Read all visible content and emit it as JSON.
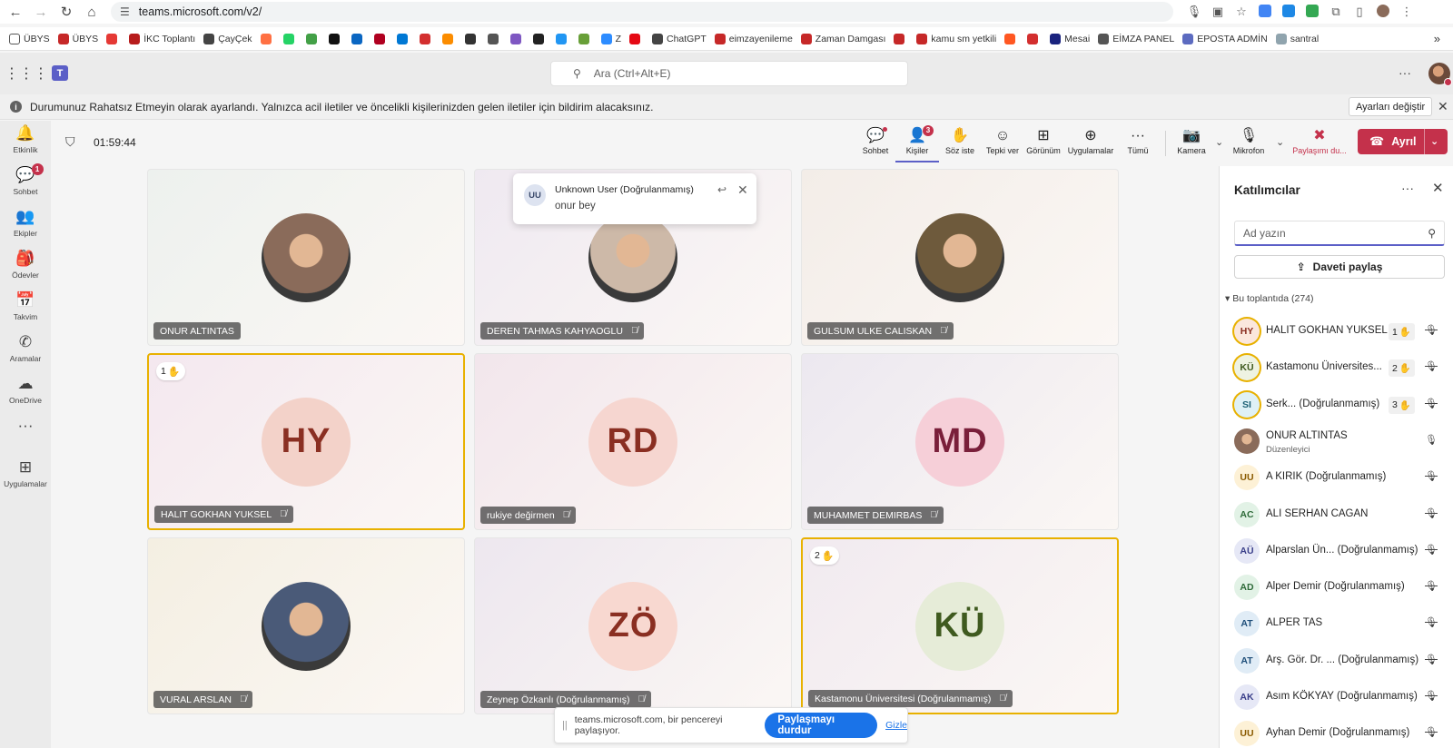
{
  "browser": {
    "url": "teams.microsoft.com/v2/",
    "bookmarks": [
      {
        "label": "ÜBYS",
        "color": "#555555"
      },
      {
        "label": "ÜBYS",
        "color": "#c62828"
      },
      {
        "label": "",
        "color": "#e53935"
      },
      {
        "label": "İKC Toplantı",
        "color": "#b71c1c"
      },
      {
        "label": "ÇayÇek",
        "color": "#444444"
      },
      {
        "label": "",
        "color": "#ff7043"
      },
      {
        "label": "",
        "color": "#25d366"
      },
      {
        "label": "",
        "color": "#43a047"
      },
      {
        "label": "",
        "color": "#111111"
      },
      {
        "label": "",
        "color": "#0a66c2"
      },
      {
        "label": "",
        "color": "#b00020"
      },
      {
        "label": "",
        "color": "#0078d4"
      },
      {
        "label": "",
        "color": "#d32f2f"
      },
      {
        "label": "",
        "color": "#fb8c00"
      },
      {
        "label": "",
        "color": "#333333"
      },
      {
        "label": "",
        "color": "#555555"
      },
      {
        "label": "",
        "color": "#7e57c2"
      },
      {
        "label": "",
        "color": "#222222"
      },
      {
        "label": "",
        "color": "#2196f3"
      },
      {
        "label": "",
        "color": "#689f38"
      },
      {
        "label": "Z",
        "color": "#2d8cff"
      },
      {
        "label": "",
        "color": "#e50914"
      },
      {
        "label": "ChatGPT",
        "color": "#444444"
      },
      {
        "label": "eimzayenileme",
        "color": "#c62828"
      },
      {
        "label": "Zaman Damgası",
        "color": "#c62828"
      },
      {
        "label": "",
        "color": "#c62828"
      },
      {
        "label": "kamu sm yetkili",
        "color": "#c62828"
      },
      {
        "label": "",
        "color": "#ff5722"
      },
      {
        "label": "",
        "color": "#d32f2f"
      },
      {
        "label": "Mesai",
        "color": "#1a237e"
      },
      {
        "label": "EİMZA PANEL",
        "color": "#555555"
      },
      {
        "label": "EPOSTA ADMİN",
        "color": "#5c6bc0"
      },
      {
        "label": "santral",
        "color": "#90a4ae"
      }
    ]
  },
  "teams": {
    "search_placeholder": "Ara (Ctrl+Alt+E)",
    "banner_text": "Durumunuz Rahatsız Etmeyin olarak ayarlandı. Yalnızca acil iletiler ve öncelikli kişilerinizden gelen iletiler için bildirim alacaksınız.",
    "banner_button": "Ayarları değiştir"
  },
  "rail": [
    {
      "label": "Etkinlik",
      "icon": "bell-icon",
      "badge": ""
    },
    {
      "label": "Sohbet",
      "icon": "chat-icon",
      "badge": "1"
    },
    {
      "label": "Ekipler",
      "icon": "teams-icon",
      "badge": ""
    },
    {
      "label": "Ödevler",
      "icon": "assignments-icon",
      "badge": ""
    },
    {
      "label": "Takvim",
      "icon": "calendar-icon",
      "badge": ""
    },
    {
      "label": "Aramalar",
      "icon": "phone-icon",
      "badge": ""
    },
    {
      "label": "OneDrive",
      "icon": "cloud-icon",
      "badge": ""
    },
    {
      "label": "...",
      "icon": "more-icon",
      "badge": ""
    },
    {
      "label": "Uygulamalar",
      "icon": "add-apps-icon",
      "badge": ""
    }
  ],
  "meeting": {
    "timer": "01:59:44",
    "toolbar": [
      {
        "label": "Sohbet",
        "icon": "chat-icon"
      },
      {
        "label": "Kişiler",
        "icon": "people-icon",
        "badge": "3"
      },
      {
        "label": "Söz iste",
        "icon": "raise-hand-icon"
      },
      {
        "label": "Tepki ver",
        "icon": "react-icon"
      },
      {
        "label": "Görünüm",
        "icon": "view-icon"
      },
      {
        "label": "Uygulamalar",
        "icon": "apps-icon"
      },
      {
        "label": "Tümü",
        "icon": "more-icon"
      },
      {
        "label": "Kamera",
        "icon": "camera-off-icon"
      },
      {
        "label": "Mikrofon",
        "icon": "mic-icon"
      },
      {
        "label": "Paylaşımı du...",
        "icon": "stop-share-icon"
      }
    ],
    "leave_label": "Ayrıl",
    "tiles": [
      {
        "name": "ONUR ALTINTAS",
        "initials": "",
        "photo": true,
        "muted": false,
        "hand": "",
        "raised": false,
        "bg": "#edf1ee",
        "avatar_bg": "#8a6b5a",
        "avatar_fg": "#ffffff"
      },
      {
        "name": "DEREN TAHMAS KAHYAOGLU",
        "initials": "",
        "photo": true,
        "muted": true,
        "hand": "",
        "raised": false,
        "bg": "#efe9f1",
        "avatar_bg": "#cdb9a8",
        "avatar_fg": "#ffffff"
      },
      {
        "name": "GULSUM ULKE CALISKAN",
        "initials": "",
        "photo": true,
        "muted": true,
        "hand": "",
        "raised": false,
        "bg": "#f3ede8",
        "avatar_bg": "#6e5a3c",
        "avatar_fg": "#ffffff"
      },
      {
        "name": "HALIT GOKHAN YUKSEL",
        "initials": "HY",
        "photo": false,
        "muted": true,
        "hand": "1",
        "raised": true,
        "bg": "#f4e8ef",
        "avatar_bg": "#f3d2c9",
        "avatar_fg": "#8a2f22"
      },
      {
        "name": "rukiye değirmen",
        "initials": "RD",
        "photo": false,
        "muted": true,
        "hand": "",
        "raised": false,
        "bg": "#f2e6ec",
        "avatar_bg": "#f6d6d0",
        "avatar_fg": "#8a2f22"
      },
      {
        "name": "MUHAMMET DEMIRBAS",
        "initials": "MD",
        "photo": false,
        "muted": true,
        "hand": "",
        "raised": false,
        "bg": "#ece8f0",
        "avatar_bg": "#f6cfd8",
        "avatar_fg": "#7a1f3a"
      },
      {
        "name": "VURAL ARSLAN",
        "initials": "",
        "photo": true,
        "muted": true,
        "hand": "",
        "raised": false,
        "bg": "#f4efe2",
        "avatar_bg": "#4a5a78",
        "avatar_fg": "#ffffff"
      },
      {
        "name": "Zeynep Özkanlı (Doğrulanmamış)",
        "initials": "ZÖ",
        "photo": false,
        "muted": true,
        "hand": "",
        "raised": false,
        "bg": "#ede7ef",
        "avatar_bg": "#f8d8d0",
        "avatar_fg": "#8a2f22"
      },
      {
        "name": "Kastamonu Üniversitesi (Doğrulanmamış)",
        "initials": "KÜ",
        "photo": false,
        "muted": true,
        "hand": "2",
        "raised": true,
        "bg": "#f1eaf0",
        "avatar_bg": "#e6ecd8",
        "avatar_fg": "#3f5a1f"
      }
    ],
    "toast": {
      "initials": "UU",
      "sender": "Unknown User (Doğrulanmamış)",
      "message": "onur bey"
    },
    "share": {
      "text": "teams.microsoft.com, bir pencereyi paylaşıyor.",
      "stop_label": "Paylaşmayı durdur",
      "hide_label": "Gizle"
    }
  },
  "participants": {
    "title": "Katılımcılar",
    "search_placeholder": "Ad yazın",
    "invite_label": "Daveti paylaş",
    "section_label": "Bu toplantıda (274)",
    "list": [
      {
        "initials": "HY",
        "name": "HALIT GOKHAN YUKSEL",
        "role": "",
        "hand": "1",
        "mic": "off",
        "ring": true,
        "bg": "#fbe7dd",
        "fg": "#8a2f22"
      },
      {
        "initials": "KÜ",
        "name": "Kastamonu Üniversites...",
        "role": "",
        "hand": "2",
        "mic": "off",
        "ring": true,
        "bg": "#eef3e2",
        "fg": "#3f5a1f"
      },
      {
        "initials": "SI",
        "name": "Serk...  (Doğrulanmamış)",
        "role": "",
        "hand": "3",
        "mic": "off",
        "ring": true,
        "bg": "#dff1f6",
        "fg": "#1b5f73"
      },
      {
        "initials": "",
        "name": "ONUR ALTINTAS",
        "role": "Düzenleyici",
        "hand": "",
        "mic": "on",
        "ring": false,
        "bg": "#8a6b5a",
        "fg": "#ffffff"
      },
      {
        "initials": "UU",
        "name": "A KIRIK (Doğrulanmamış)",
        "role": "",
        "hand": "",
        "mic": "off",
        "ring": false,
        "bg": "#fdf1d6",
        "fg": "#8a5a00"
      },
      {
        "initials": "AC",
        "name": "ALI SERHAN CAGAN",
        "role": "",
        "hand": "",
        "mic": "off",
        "ring": false,
        "bg": "#e2f2e6",
        "fg": "#2f6b3a"
      },
      {
        "initials": "AÜ",
        "name": "Alparslan Ün... (Doğrulanmamış)",
        "role": "",
        "hand": "",
        "mic": "off",
        "ring": false,
        "bg": "#e6e8f6",
        "fg": "#3a3f8a"
      },
      {
        "initials": "AD",
        "name": "Alper Demir (Doğrulanmamış)",
        "role": "",
        "hand": "",
        "mic": "off",
        "ring": false,
        "bg": "#e2f2e6",
        "fg": "#2f6b3a"
      },
      {
        "initials": "AT",
        "name": "ALPER TAS",
        "role": "",
        "hand": "",
        "mic": "off",
        "ring": false,
        "bg": "#e0ecf6",
        "fg": "#1f4f7a"
      },
      {
        "initials": "AT",
        "name": "Arş. Gör. Dr. ...  (Doğrulanmamış)",
        "role": "",
        "hand": "",
        "mic": "off",
        "ring": false,
        "bg": "#e0ecf6",
        "fg": "#1f4f7a"
      },
      {
        "initials": "AK",
        "name": "Asım KÖKYAY (Doğrulanmamış)",
        "role": "",
        "hand": "",
        "mic": "off",
        "ring": false,
        "bg": "#e6e8f6",
        "fg": "#3a3f8a"
      },
      {
        "initials": "UU",
        "name": "Ayhan Demir (Doğrulanmamış)",
        "role": "",
        "hand": "",
        "mic": "off",
        "ring": false,
        "bg": "#fdf1d6",
        "fg": "#8a5a00"
      }
    ]
  }
}
